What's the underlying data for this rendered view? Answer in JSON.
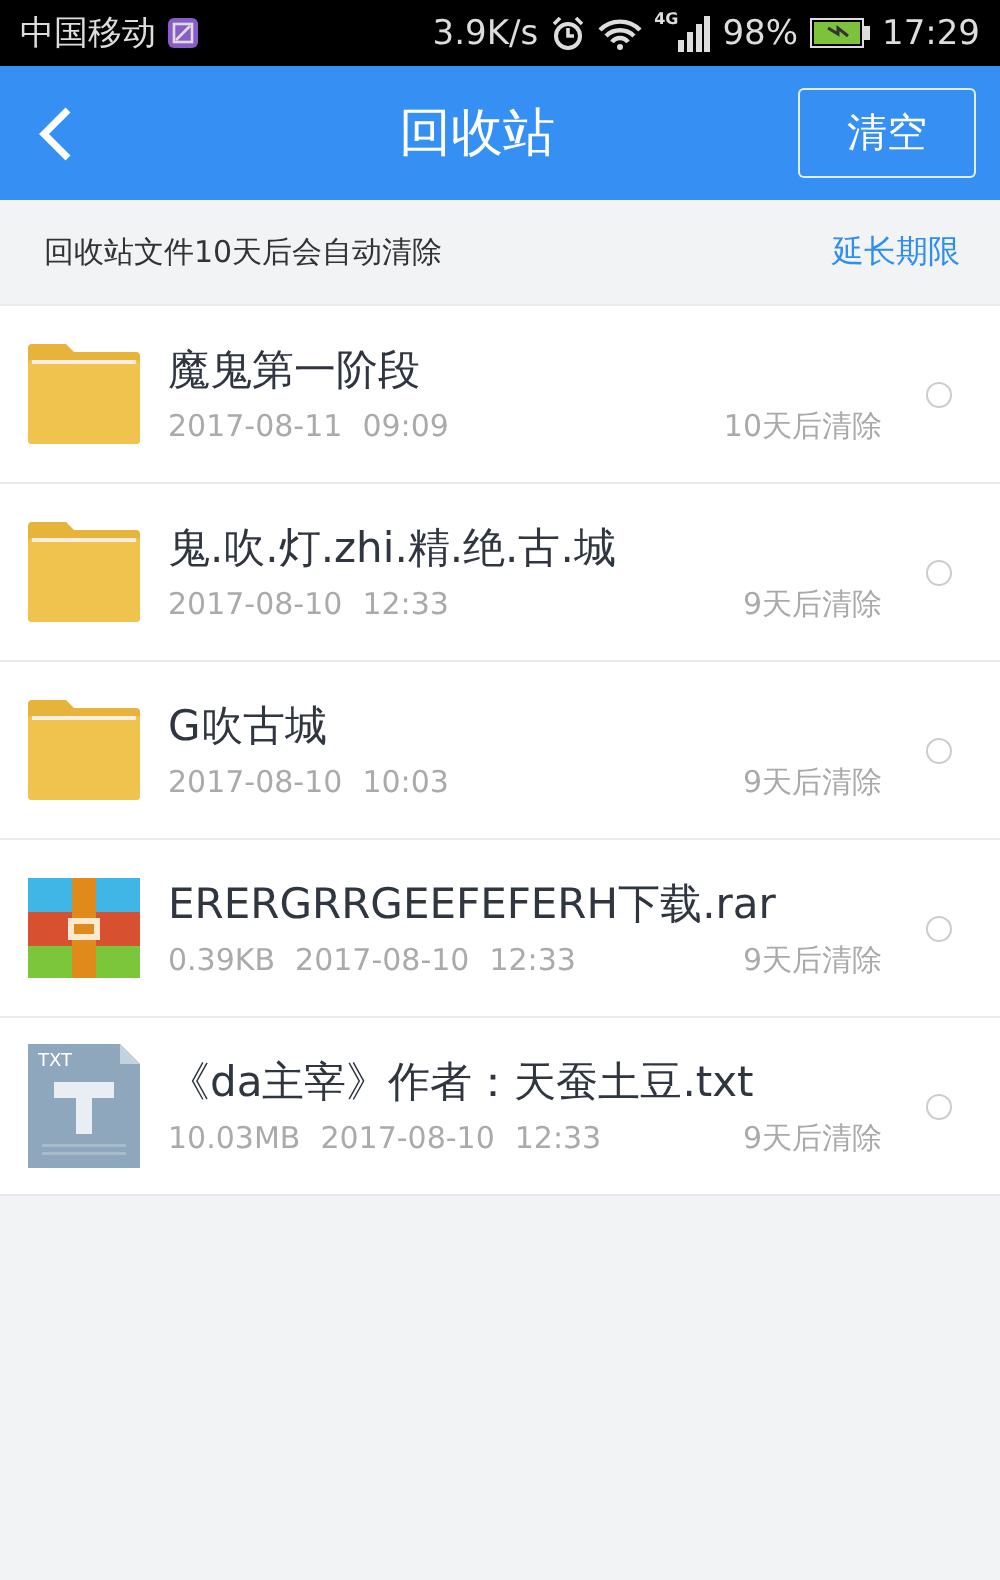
{
  "status_bar": {
    "carrier": "中国移动",
    "speed": "3.9K/s",
    "network": "4G",
    "battery": "98%",
    "time": "17:29"
  },
  "header": {
    "title": "回收站",
    "action": "清空"
  },
  "notice": {
    "text": "回收站文件10天后会自动清除",
    "link": "延长期限"
  },
  "files": [
    {
      "kind": "folder",
      "name": "魔鬼第一阶段",
      "date": "2017-08-11",
      "time": "09:09",
      "expiry": "10天后清除",
      "selected": false
    },
    {
      "kind": "folder",
      "name": "鬼.吹.灯.zhi.精.绝.古.城",
      "date": "2017-08-10",
      "time": "12:33",
      "expiry": "9天后清除",
      "selected": false
    },
    {
      "kind": "folder",
      "name": "G吹古城",
      "date": "2017-08-10",
      "time": "10:03",
      "expiry": "9天后清除",
      "selected": false
    },
    {
      "kind": "archive",
      "name": "ERERGRRGEEFEFERH下载.rar",
      "size": "0.39KB",
      "date": "2017-08-10",
      "time": "12:33",
      "expiry": "9天后清除",
      "selected": false
    },
    {
      "kind": "text",
      "icon_label": "TXT",
      "name": "《da主宰》作者：天蚕土豆.txt",
      "size": "10.03MB",
      "date": "2017-08-10",
      "time": "12:33",
      "expiry": "9天后清除",
      "selected": false
    }
  ]
}
